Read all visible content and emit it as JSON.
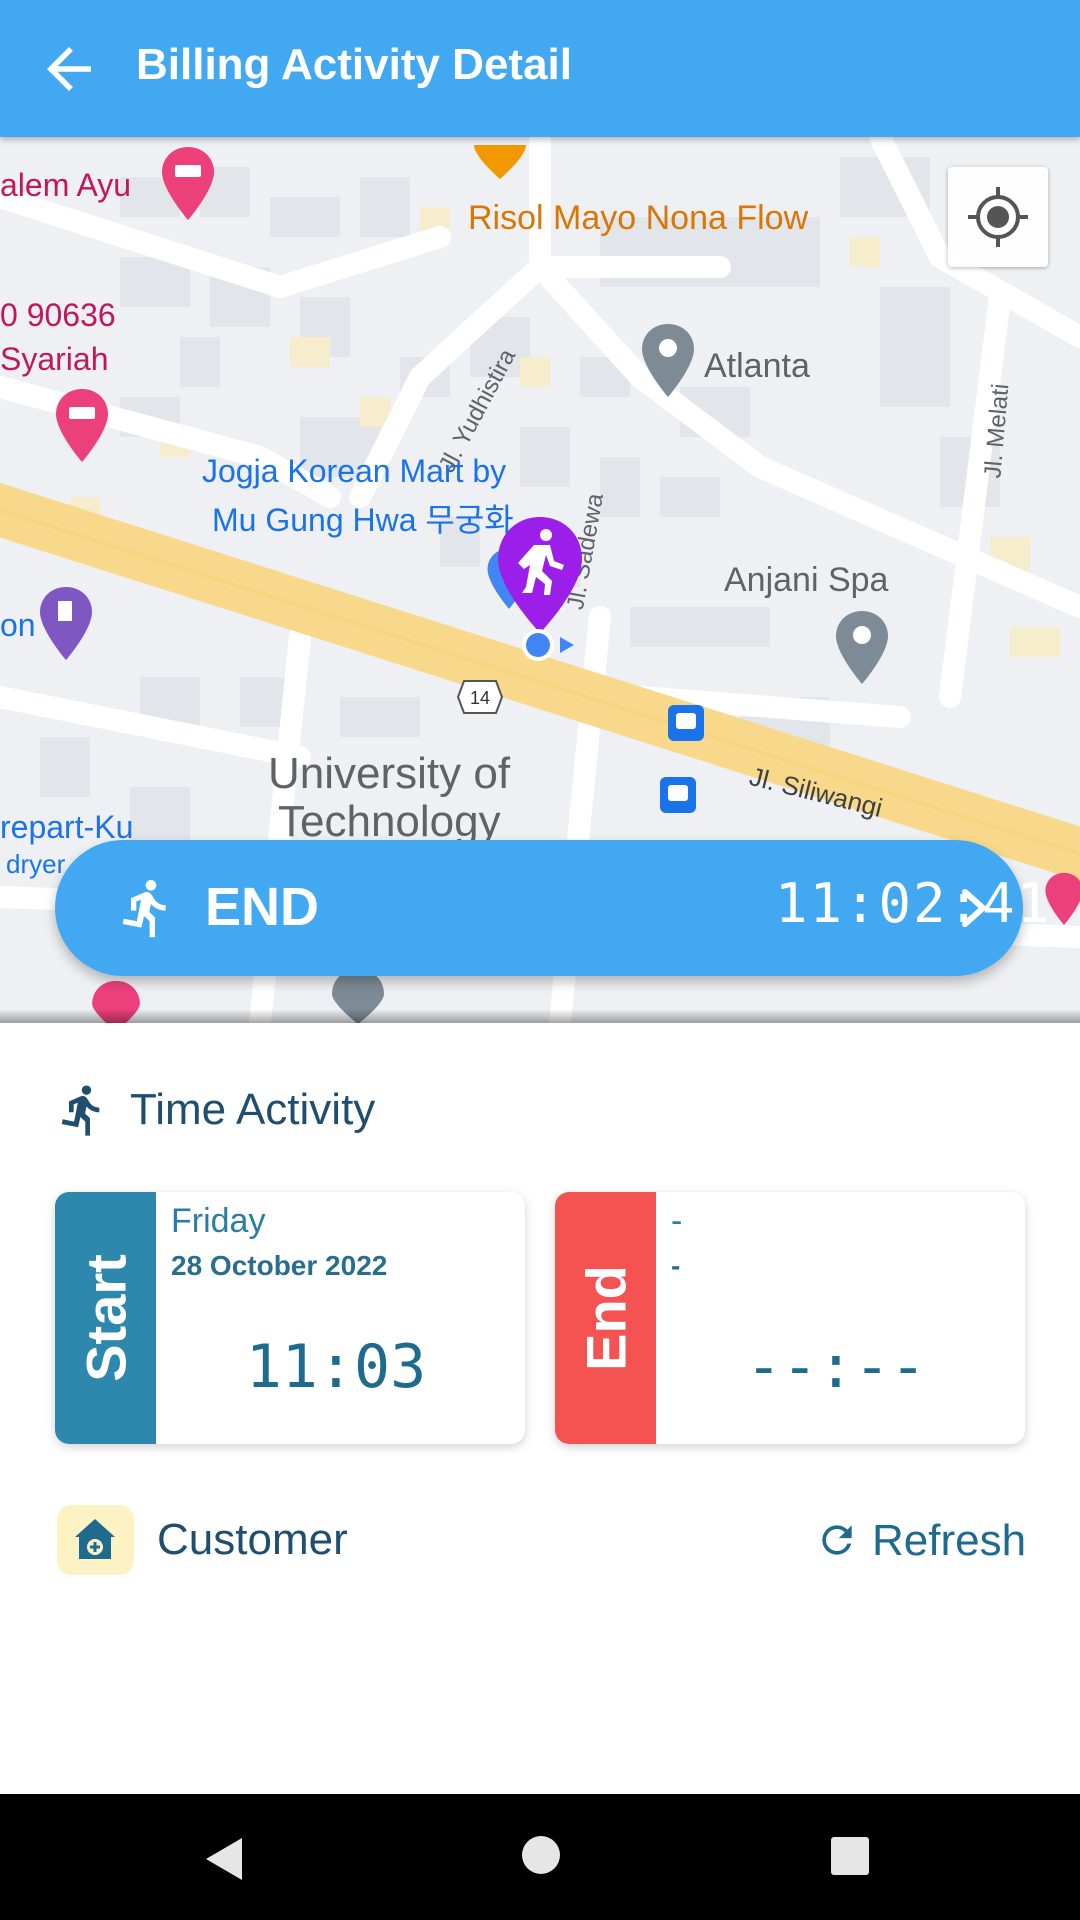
{
  "appbar": {
    "title": "Billing Activity Detail",
    "back_icon": "arrow-back-icon"
  },
  "map": {
    "labels": {
      "salem_ayu": "alem Ayu",
      "risol": "Risol Mayo Nona Flow",
      "phone": "0 90636",
      "syariah": "Syariah",
      "atlanta": "Atlanta",
      "yudhistira": "Jl. Yudhistira",
      "melati": "Jl. Melati",
      "jogja1": "Jogja Korean Mart by",
      "jogja2": "Mu Gung Hwa 무궁화",
      "anjani": "Anjani Spa",
      "on": "on",
      "sadewa": "Jl. Sadewa",
      "route14": "14",
      "univ1": "University of",
      "univ2": "Technology",
      "siliwangi": "Jl. Siliwangi",
      "repart": "repart-Ku",
      "dryer": "dryer"
    }
  },
  "end_bar": {
    "label": "END",
    "timer": "11:02:41"
  },
  "time_activity": {
    "title": "Time Activity",
    "start": {
      "side_label": "Start",
      "day": "Friday",
      "date": "28 October 2022",
      "time": "11:03",
      "color": "#2e88ad"
    },
    "end": {
      "side_label": "End",
      "day": "-",
      "date": "-",
      "time": "--:--",
      "color": "#f55252"
    }
  },
  "customer": {
    "label": "Customer",
    "refresh_label": "Refresh"
  },
  "colors": {
    "primary": "#42a8f1",
    "pin_purple": "#9b1fe8"
  }
}
